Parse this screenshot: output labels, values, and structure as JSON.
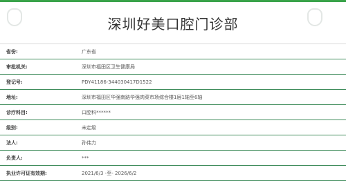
{
  "header": {
    "title": "深圳好美口腔门诊部",
    "accent_color": "#3aa34a",
    "row_divider_color": "#3f8c5b",
    "watermark_icon": "tooth-icon"
  },
  "rows": [
    {
      "label": "省份:",
      "value": "广东省"
    },
    {
      "label": "审批机关:",
      "value": "深圳市福田区卫生健康局"
    },
    {
      "label": "登记号:",
      "value": "PDY41186-344030417D1522"
    },
    {
      "label": "地址:",
      "value": "深圳市福田区华强南路华强肉菜市场综合楼1层1轴至6轴"
    },
    {
      "label": "诊疗科目:",
      "value": "口腔科******"
    },
    {
      "label": "级别:",
      "value": "未定级"
    },
    {
      "label": "法人:",
      "value": "孙伟力"
    },
    {
      "label": "负责人:",
      "value": "***"
    },
    {
      "label": "执业许可证有效期:",
      "value": "2021/6/3 -至- 2026/6/2"
    }
  ]
}
